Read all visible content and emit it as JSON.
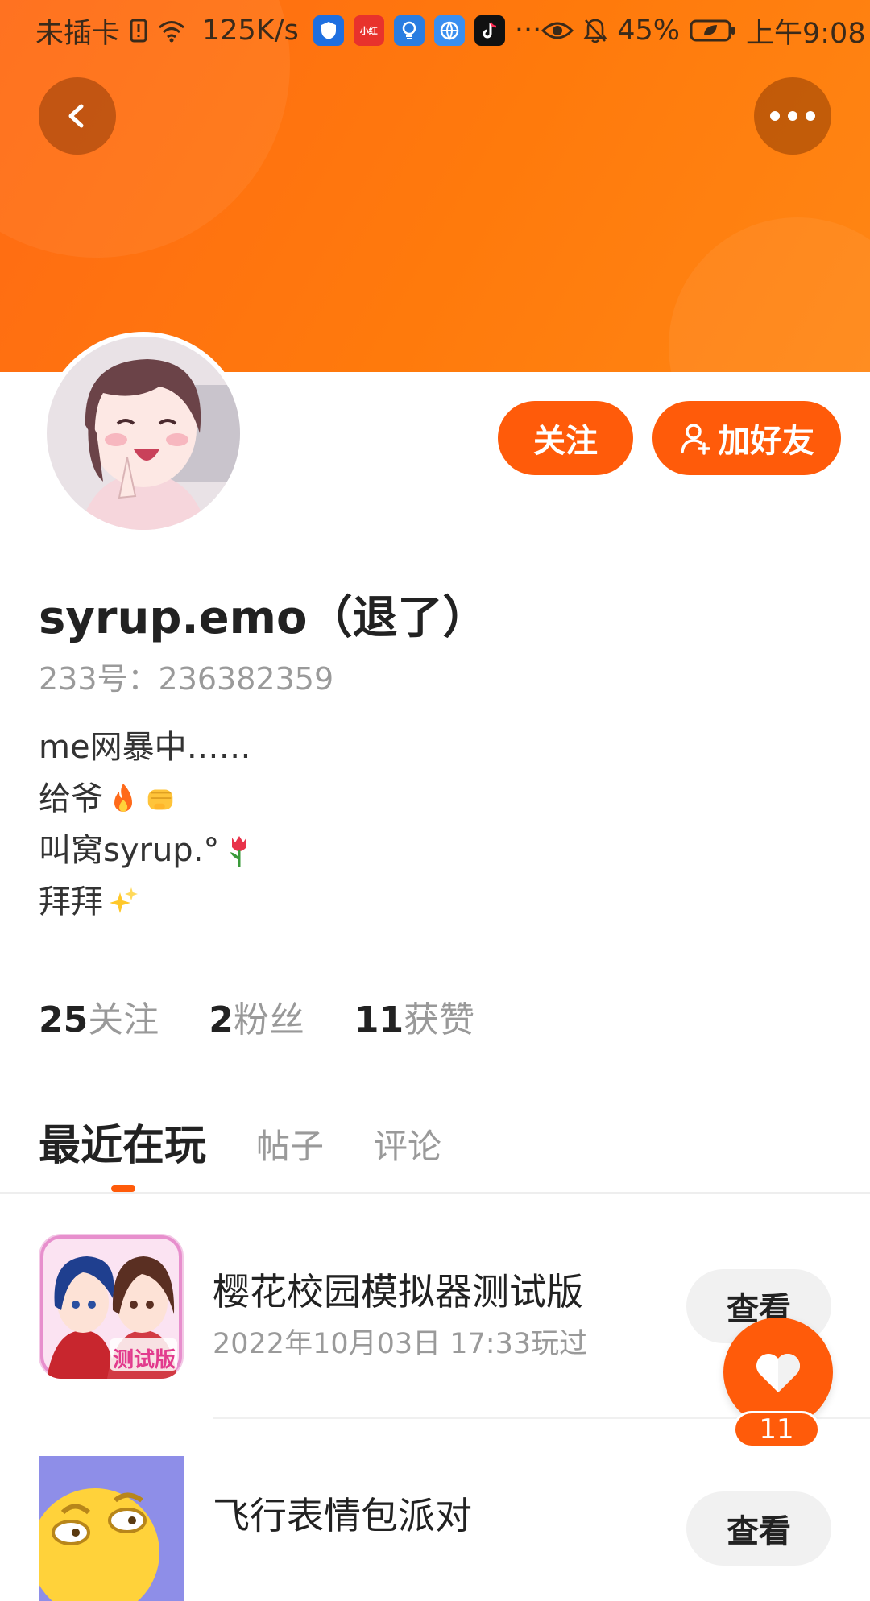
{
  "status_bar": {
    "carrier": "未插卡",
    "net_speed": "125K/s",
    "more": "···",
    "battery": "45%",
    "time": "上午9:08",
    "app_icons": [
      "shield-app-icon",
      "xiaohongshu-app-icon",
      "lightbulb-app-icon",
      "browser-app-icon",
      "tiktok-app-icon"
    ]
  },
  "profile": {
    "username": "syrup.emo（退了）",
    "uid": "233号：236382359",
    "bio": [
      "me网暴中……",
      "给爷",
      "叫窝syrup.°",
      "拜拜"
    ],
    "follow_label": "关注",
    "add_friend_label": "加好友"
  },
  "stats": [
    {
      "value": "25",
      "label": "关注"
    },
    {
      "value": "2",
      "label": "粉丝"
    },
    {
      "value": "11",
      "label": "获赞"
    }
  ],
  "tabs": [
    {
      "label": "最近在玩",
      "active": true
    },
    {
      "label": "帖子",
      "active": false
    },
    {
      "label": "评论",
      "active": false
    }
  ],
  "games": [
    {
      "name": "樱花校园模拟器测试版",
      "played": "2022年10月03日 17:33玩过",
      "button": "查看",
      "badge": "测试版"
    },
    {
      "name": "飞行表情包派对",
      "played": "",
      "button": "查看"
    }
  ],
  "like_fab": {
    "count": "11"
  },
  "colors": {
    "accent": "#ff5b0a",
    "header_start": "#ff6a14",
    "header_end": "#ff8614"
  }
}
